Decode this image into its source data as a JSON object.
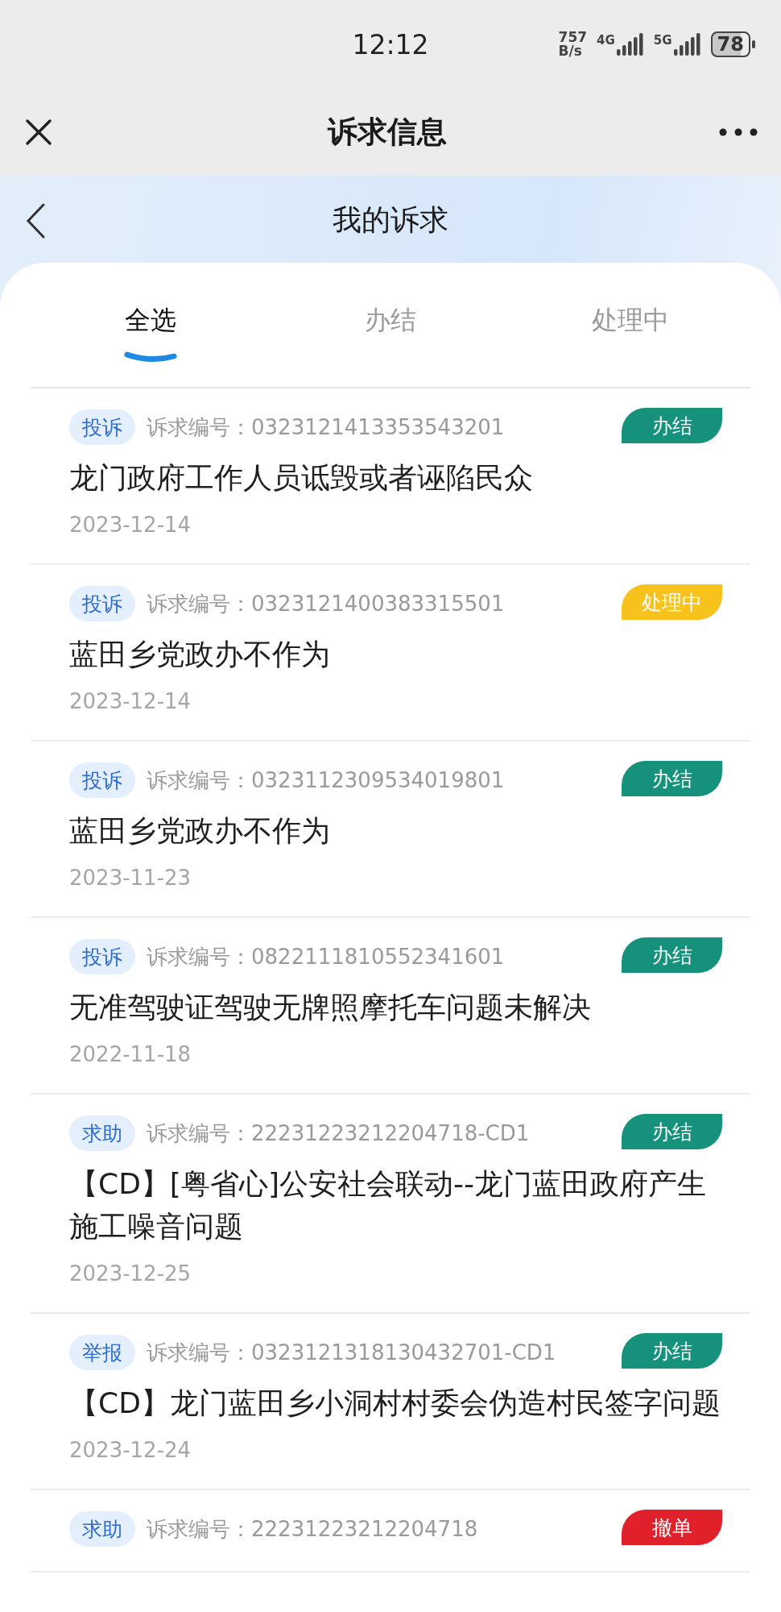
{
  "status_bar": {
    "time": "12:12",
    "speed": [
      "757",
      "B/s"
    ],
    "networks": [
      "4G",
      "5G"
    ],
    "battery": "78"
  },
  "title_bar": {
    "title": "诉求信息"
  },
  "header": {
    "title": "我的诉求"
  },
  "tabs": [
    {
      "label": "全选",
      "selected": true
    },
    {
      "label": "办结",
      "selected": false
    },
    {
      "label": "处理中",
      "selected": false
    }
  ],
  "requests": [
    {
      "type": "投诉",
      "number": "诉求编号：0323121413353543201",
      "status": {
        "label": "办结",
        "color": "#16927c"
      },
      "title": "龙门政府工作人员诋毁或者诬陷民众",
      "date": "2023-12-14"
    },
    {
      "type": "投诉",
      "number": "诉求编号：0323121400383315501",
      "status": {
        "label": "处理中",
        "color": "#f6c21b"
      },
      "title": "蓝田乡党政办不作为",
      "date": "2023-12-14"
    },
    {
      "type": "投诉",
      "number": "诉求编号：0323112309534019801",
      "status": {
        "label": "办结",
        "color": "#16927c"
      },
      "title": "蓝田乡党政办不作为",
      "date": "2023-11-23"
    },
    {
      "type": "投诉",
      "number": "诉求编号：0822111810552341601",
      "status": {
        "label": "办结",
        "color": "#16927c"
      },
      "title": "无准驾驶证驾驶无牌照摩托车问题未解决",
      "date": "2022-11-18"
    },
    {
      "type": "求助",
      "number": "诉求编号：22231223212204718-CD1",
      "status": {
        "label": "办结",
        "color": "#16927c"
      },
      "title": "【CD】[粤省心]公安社会联动--龙门蓝田政府产生施工噪音问题",
      "date": "2023-12-25"
    },
    {
      "type": "举报",
      "number": "诉求编号：0323121318130432701-CD1",
      "status": {
        "label": "办结",
        "color": "#16927c"
      },
      "title": "【CD】龙门蓝田乡小洞村村委会伪造村民签字问题",
      "date": "2023-12-24"
    },
    {
      "type": "求助",
      "number": "诉求编号：22231223212204718",
      "status": {
        "label": "撤单",
        "color": "#e0202a"
      }
    }
  ]
}
